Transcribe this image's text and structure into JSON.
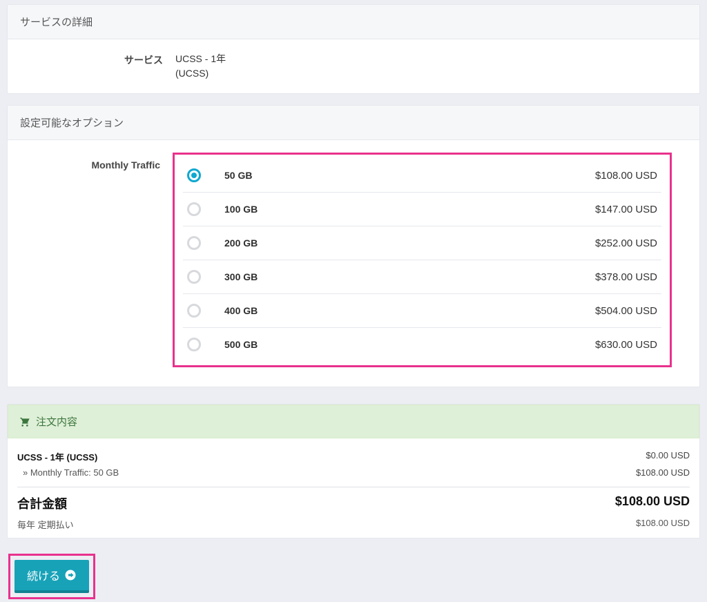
{
  "service_panel": {
    "title": "サービスの詳細",
    "label": "サービス",
    "value_line1": "UCSS - 1年",
    "value_line2": "(UCSS)"
  },
  "options_panel": {
    "title": "設定可能なオプション",
    "label": "Monthly Traffic",
    "items": [
      {
        "label": "50 GB",
        "price": "$108.00 USD",
        "selected": true
      },
      {
        "label": "100 GB",
        "price": "$147.00 USD",
        "selected": false
      },
      {
        "label": "200 GB",
        "price": "$252.00 USD",
        "selected": false
      },
      {
        "label": "300 GB",
        "price": "$378.00 USD",
        "selected": false
      },
      {
        "label": "400 GB",
        "price": "$504.00 USD",
        "selected": false
      },
      {
        "label": "500 GB",
        "price": "$630.00 USD",
        "selected": false
      }
    ]
  },
  "summary": {
    "title": "注文内容",
    "product_name": "UCSS - 1年 (UCSS)",
    "product_price": "$0.00 USD",
    "option_line": "» Monthly Traffic: 50 GB",
    "option_price": "$108.00 USD",
    "total_label": "合計金額",
    "total_value": "$108.00 USD",
    "recurring_label": "毎年 定期払い",
    "recurring_value": "$108.00 USD"
  },
  "cta": {
    "label": "続ける"
  }
}
